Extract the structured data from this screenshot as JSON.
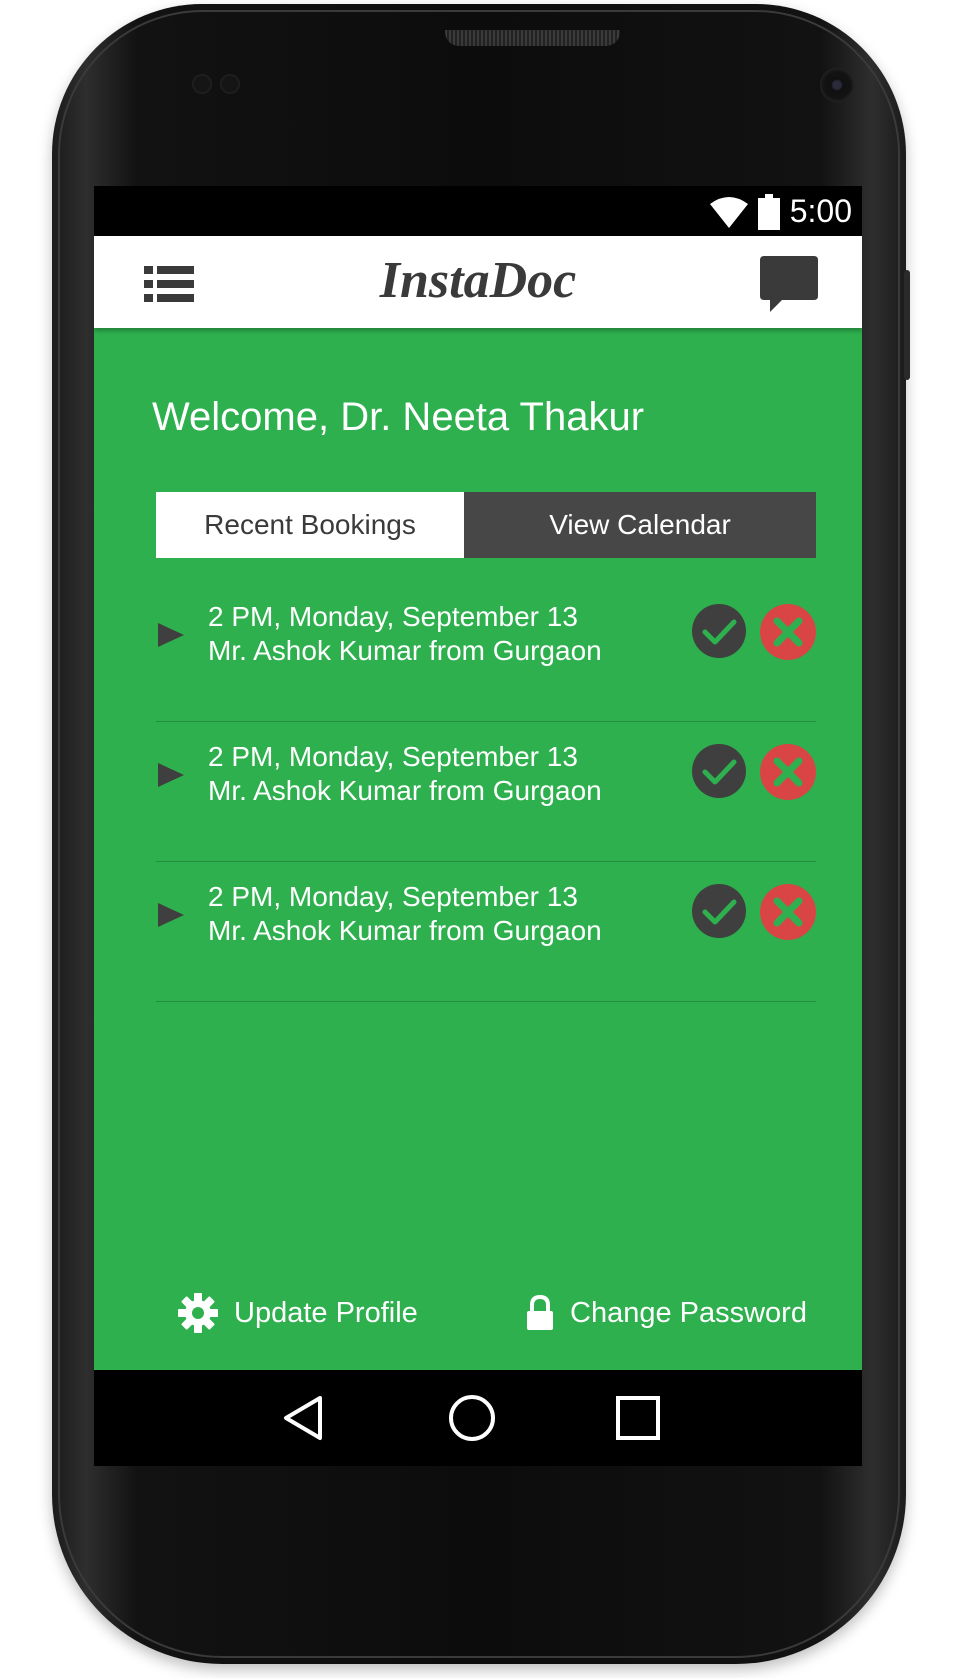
{
  "status_bar": {
    "time": "5:00",
    "icons": [
      "wifi-icon",
      "battery-icon"
    ]
  },
  "app_bar": {
    "title": "InstaDoc",
    "left_icon": "menu-list-icon",
    "right_icon": "chat-icon"
  },
  "welcome_text": "Welcome, Dr. Neeta Thakur",
  "tabs": [
    {
      "label": "Recent Bookings",
      "selected": true
    },
    {
      "label": "View Calendar",
      "selected": false
    }
  ],
  "bookings": [
    {
      "when": "2 PM, Monday, September 13",
      "who": "Mr. Ashok Kumar from Gurgaon"
    },
    {
      "when": "2 PM, Monday, September 13",
      "who": "Mr. Ashok Kumar from Gurgaon"
    },
    {
      "when": "2 PM, Monday, September 13",
      "who": "Mr. Ashok Kumar from Gurgaon"
    }
  ],
  "footer": {
    "update_profile": "Update Profile",
    "change_password": "Change Password",
    "update_profile_icon": "gear-icon",
    "change_password_icon": "lock-icon"
  },
  "nav": [
    "back-icon",
    "home-icon",
    "recents-icon"
  ],
  "colors": {
    "screen_bg": "#2eb04e",
    "tab_active_bg": "#ffffff",
    "tab_inactive_bg": "#474747",
    "accept": "#3f3f3f",
    "reject": "#d94545",
    "text_dark": "#3a3a3a"
  }
}
